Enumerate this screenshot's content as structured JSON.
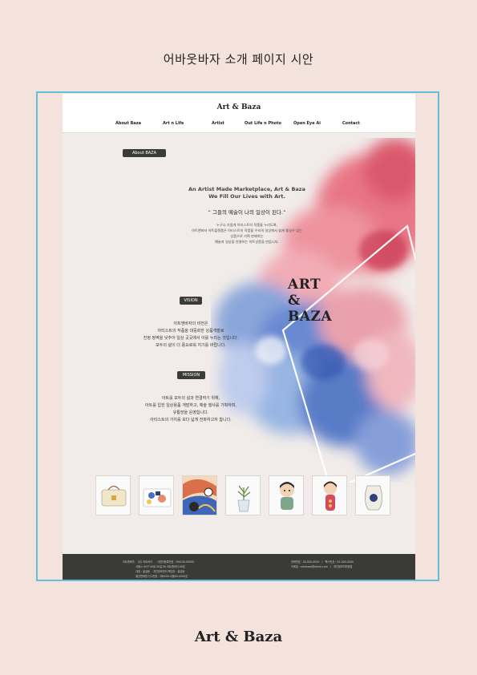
{
  "page_title": "어바웃바자 소개 페이지 시안",
  "header": {
    "brand": "Art & Baza",
    "nav": [
      "About Baza",
      "Art n Life",
      "Artist",
      "Out Life n Photo",
      "Open Eye Ai",
      "Contact"
    ]
  },
  "about": {
    "badge": "About   BAZA",
    "tagline_1": "An Artist Made Marketplace, Art & Baza",
    "tagline_2": "We Fill Our Lives with Art.",
    "quote": "“ 그들의 예술이 나의 일상이 된다.”",
    "body": [
      "누구나 가깝게 아티스트의 작품을 누리도록,",
      "아트앤바자 아트플랫폼은 아티스트의 작품을 우리의 일상에서 쉽게 즐길수 있는",
      "상품으로 기획 판매하는",
      "예술과 일상을 연결하는 아트상품을 만듭니다."
    ]
  },
  "hero_logo": [
    "ART",
    "&",
    "BAZA"
  ],
  "vision": {
    "badge": "VISION",
    "lines": [
      "아트앤바자의 비전은",
      "아티스트의 작품을 대중화한 상품개발로",
      "진정 정벽을 낮추어 일상 곳곳에서 이를 누리는 것입니다.",
      "모두의 삶이 더 풍요로워 지기를 바랍니다."
    ]
  },
  "mission": {
    "badge": "MISSION",
    "lines": [
      "아트를 모두의 삶과 연결하기 위해,",
      "아트를 입힌 일상용품 개발하고, 예술 행사를 기획하며,",
      "유통망을 운영합니다.",
      "아티스트의 가치를 보다 넓게 전파하고자 합니다."
    ]
  },
  "products": [
    "bag",
    "tray",
    "painting",
    "plant-vase",
    "figure-boy",
    "kokeshi-doll",
    "ceramic-vase"
  ],
  "footer": {
    "left": "아트앤바자    (주) 아트바자      사업자등록번호 : 000-00-00000\n                서울시 00구 00로 00길 00 아트앤바자 00호\n                대표 : 홍길동    개인정보관리 책임자 : 홍길동\n                통신판매업 신고번호 : 제0000-서울00-0000호",
    "right": "전화번호 : 02-000-0000   /   팩스번호 : 02-000-0000\n이메일 : artnbaza@email.com   /   개인정보처리방침"
  },
  "bottom_logo": "Art & Baza",
  "colors": {
    "background": "#f4e3dd",
    "frame": "#5fbfdc",
    "footer": "#3a3a37",
    "badge": "#3b3b38"
  }
}
